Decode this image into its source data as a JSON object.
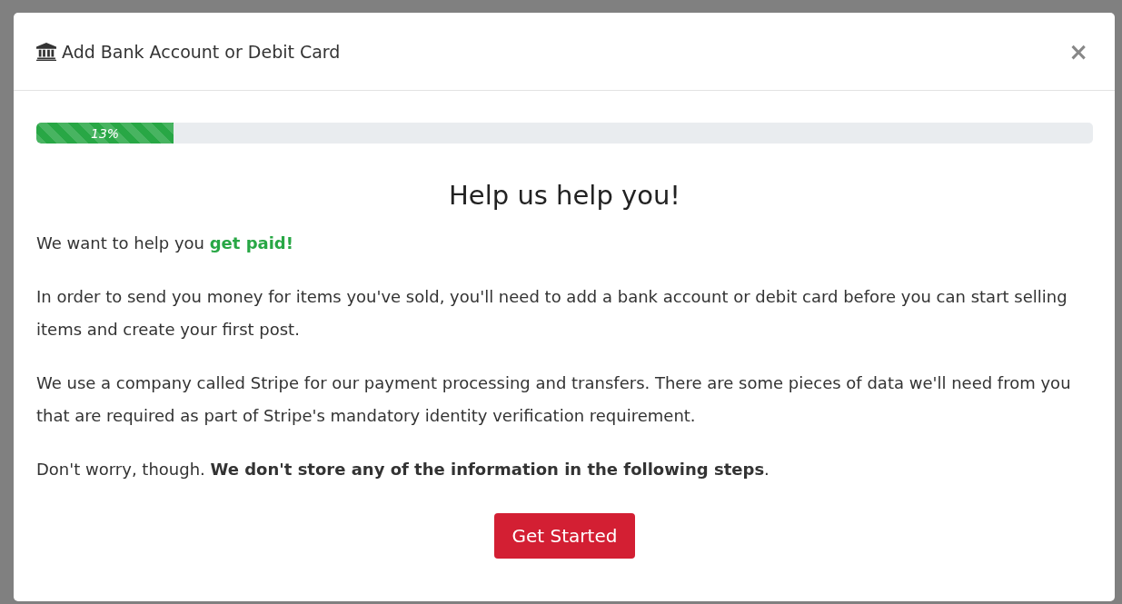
{
  "modal": {
    "title": "Add Bank Account or Debit Card",
    "close": "×"
  },
  "progress": {
    "level": 0.13,
    "label": "13%"
  },
  "heading": "Help us help you!",
  "paragraphs": [
    {
      "text": "We want to help you **get paid!**",
      "accent": true
    },
    {
      "text": "In order to send you money for items you've sold, you'll need to add a bank account or debit card before you can start selling items and create your first post."
    },
    {
      "text": "We use a company called Stripe for our payment processing and transfers. There are some pieces of data we'll need from you that are required as part of Stripe's mandatory identity verification requirement."
    },
    {
      "text": "Don't worry, though. **We don't store any of the information in the following steps**.",
      "accent": false
    }
  ],
  "button": "Get Started"
}
